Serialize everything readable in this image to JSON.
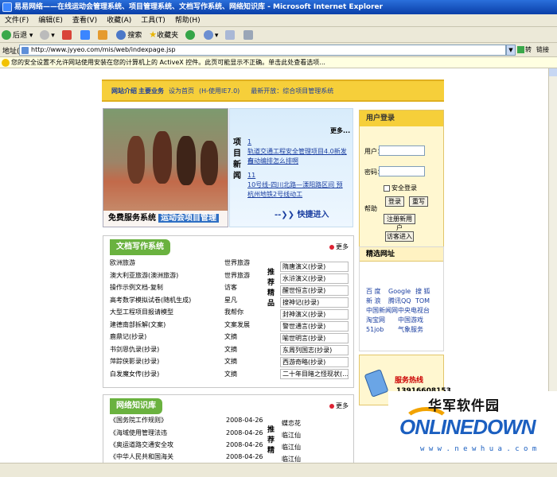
{
  "window": {
    "title": "易易网络——在线运动会管理系统、项目管理系统、文档写作系统、网络知识库 - Microsoft Internet Explorer"
  },
  "menu": [
    "文件(F)",
    "编辑(E)",
    "查看(V)",
    "收藏(A)",
    "工具(T)",
    "帮助(H)"
  ],
  "toolbar": {
    "back": "后退",
    "search": "搜索",
    "favorites": "收藏夹"
  },
  "address": {
    "label": "地址(D)",
    "url": "http://www.jyyeo.com/mis/web/indexpage.jsp",
    "go": "转到",
    "links": "链接"
  },
  "infobar": "您的安全设置不允许网站使用安装在您的计算机上的 ActiveX 控件。此页可能显示不正确。单击此处查看选项...",
  "nav": {
    "a": "网站介绍",
    "b": "主要业务",
    "c": "设为首页",
    "d": "(H-使用IE7.0)",
    "e": "最新开放：综合项目管理系统"
  },
  "banner": {
    "text": "免费服务系统",
    "highlight": "运动会项目管理"
  },
  "news": {
    "title": "项目新闻",
    "more": "更多...",
    "items": [
      "1",
      "轨道交通工程安全管理项目4.0新发布",
      "自动编排怎么排啊",
      "11",
      "10号线-四川北路—溧阳路区间 预",
      "杭州地铁2号线动工"
    ],
    "quick_join": "快捷进入"
  },
  "login": {
    "title": "用户登录",
    "user_label": "用户：",
    "pwd_label": "密码：",
    "safe": "安全登录",
    "help": "帮助",
    "login_btn": "登录",
    "rewrite_btn": "重写",
    "register_btn": "注册新用户",
    "guest_btn": "访客进入"
  },
  "doc_section": {
    "title": "文档写作系统",
    "more": "更多",
    "rows": [
      {
        "left": "欧洲旅游",
        "right": "世界旅游"
      },
      {
        "left": "澳大利亚旅游(澳洲旅游)",
        "right": "世界旅游"
      },
      {
        "left": "操作示例文档-复制",
        "right": "访客"
      },
      {
        "left": "高考数学模拟试卷(随机生成)",
        "right": "星凡"
      },
      {
        "left": "大型工程项目报请模型",
        "right": "我帮你"
      },
      {
        "left": "建德南部拆解(文案)",
        "right": "文案发展"
      },
      {
        "left": "鹿鼎记(抄录)",
        "right": "文摘"
      },
      {
        "left": "书剑恩仇录(抄录)",
        "right": "文摘"
      },
      {
        "left": "萍踪侠影录(抄录)",
        "right": "文摘"
      },
      {
        "left": "白发魔女传(抄录)",
        "right": "文摘"
      }
    ],
    "rec_label": "推荐精品",
    "rec": [
      "隋唐演义(抄录)",
      "水浒演义(抄录)",
      "醒世恒言(抄录)",
      "搜神记(抄录)",
      "封神演义(抄录)",
      "警世通言(抄录)",
      "喻世明言(抄录)",
      "东周列国志(抄录)",
      "西游奇略(抄录)",
      "二十年目睹之怪现状(…"
    ]
  },
  "links_section": {
    "title": "精选网址",
    "items": [
      [
        "百 度",
        "Google",
        "搜 狐"
      ],
      [
        "新 浪",
        "腾讯QQ",
        "TOM"
      ],
      [
        "中国新闻网",
        "中央电视台"
      ],
      [
        "淘宝网",
        "中国游戏"
      ],
      [
        "51job",
        "气象服务"
      ]
    ]
  },
  "hotline": {
    "title": "服务热线",
    "number": "13916608153"
  },
  "kb_section": {
    "title": "网络知识库",
    "more": "更多",
    "rows": [
      {
        "left": "《国务院工作规则》",
        "date": "2008-04-26"
      },
      {
        "left": "《海域使用管理法违",
        "date": "2008-04-26"
      },
      {
        "left": "《奥运道路交通安全攻",
        "date": "2008-04-26"
      },
      {
        "left": "《中华人民共和国海关",
        "date": "2008-04-26"
      }
    ],
    "rec_label": "推荐精",
    "rec": [
      "蝶恋花",
      "临江仙",
      "临江仙",
      "临江仙"
    ]
  },
  "watermark": {
    "cn": "华军软件园",
    "en": "ONLINEDOWN",
    "url": "w w w . n e w h u a . c o m"
  },
  "colors": {
    "nav_yellow": "#f6cf3a",
    "section_green": "#6ab23f",
    "link_blue": "#1a3ea0",
    "xp_blue": "#0a3fa8"
  }
}
